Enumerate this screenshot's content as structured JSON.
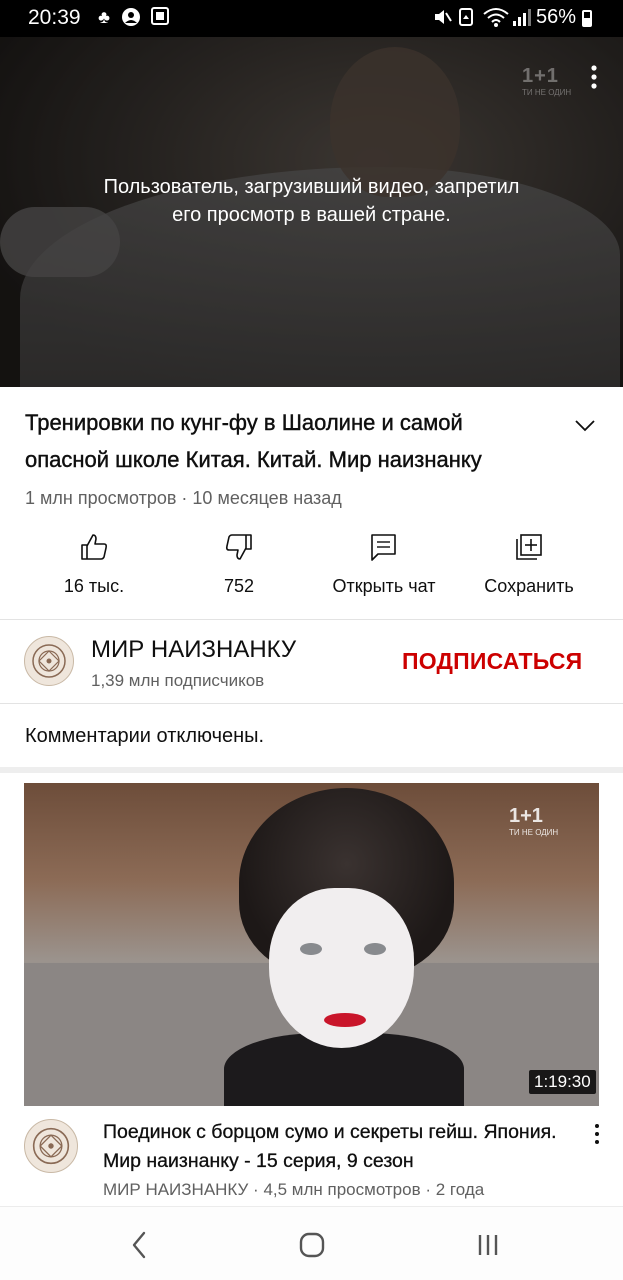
{
  "status_bar": {
    "time": "20:39",
    "battery": "56%"
  },
  "player": {
    "blocked_message": "Пользователь, загрузивший видео, запретил его просмотр в вашей стране.",
    "watermark": "1+1",
    "watermark_sub": "ТИ НЕ ОДИН"
  },
  "video": {
    "title": "Тренировки по кунг-фу в Шаолине и самой опасной школе Китая. Китай. Мир наизнанку",
    "views": "1 млн просмотров",
    "age": "10 месяцев назад",
    "separator": " · "
  },
  "actions": [
    {
      "label": "16 тыс.",
      "icon": "thumbs-up-icon"
    },
    {
      "label": "752",
      "icon": "thumbs-down-icon"
    },
    {
      "label": "Открыть чат",
      "icon": "chat-icon"
    },
    {
      "label": "Сохранить",
      "icon": "save-playlist-icon"
    }
  ],
  "channel": {
    "name": "МИР НАИЗНАНКУ",
    "subscribers": "1,39 млн подписчиков",
    "subscribe_label": "ПОДПИСАТЬСЯ"
  },
  "comments": {
    "status": "Комментарии отключены."
  },
  "recommended": {
    "duration": "1:19:30",
    "watermark": "1+1",
    "watermark_sub": "ТИ НЕ ОДИН",
    "title": "Поединок с борцом сумо и секреты гейш. Япония. Мир наизнанку - 15 серия, 9 сезон",
    "meta": "МИР НАИЗНАНКУ · 4,5 млн просмотров · 2 года"
  },
  "colors": {
    "accent_red": "#cc0000",
    "text_primary": "#0f0f0f",
    "text_secondary": "#606060"
  }
}
